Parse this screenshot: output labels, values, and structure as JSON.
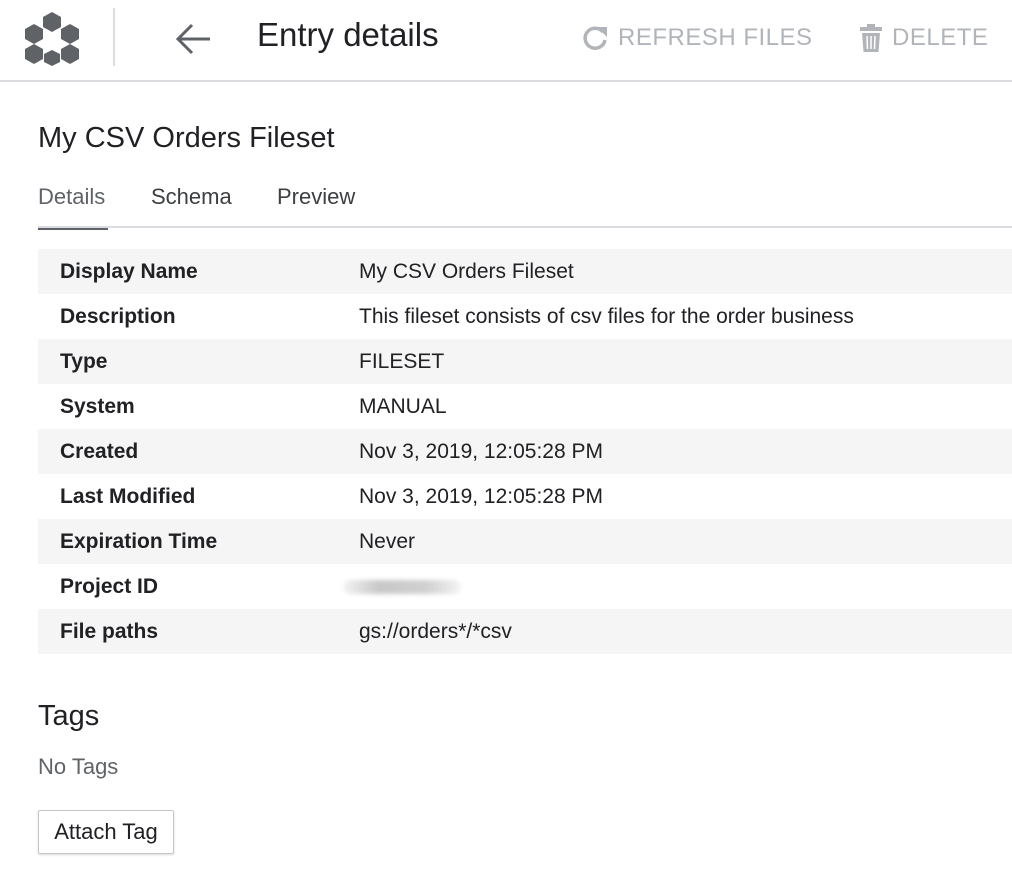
{
  "header": {
    "title": "Entry details",
    "logo_icon": "data-catalog-hexagon-icon",
    "back_icon": "arrow-left-icon",
    "refresh": {
      "label": "REFRESH FILES",
      "icon": "refresh-icon"
    },
    "delete": {
      "label": "DELETE",
      "icon": "trash-icon"
    },
    "disabled_color": "#b1b5ba"
  },
  "entry": {
    "name": "My CSV Orders Fileset"
  },
  "tabs": [
    {
      "label": "Details",
      "active": true
    },
    {
      "label": "Schema",
      "active": false
    },
    {
      "label": "Preview",
      "active": false
    }
  ],
  "details": {
    "rows": [
      {
        "label": "Display Name",
        "value": "My CSV Orders Fileset"
      },
      {
        "label": "Description",
        "value": "This fileset consists of csv files for the order business"
      },
      {
        "label": "Type",
        "value": "FILESET"
      },
      {
        "label": "System",
        "value": "MANUAL"
      },
      {
        "label": "Created",
        "value": "Nov 3, 2019, 12:05:28 PM"
      },
      {
        "label": "Last Modified",
        "value": "Nov 3, 2019, 12:05:28 PM"
      },
      {
        "label": "Expiration Time",
        "value": "Never"
      },
      {
        "label": "Project ID",
        "value": ""
      },
      {
        "label": "File paths",
        "value": "gs://orders*/*csv"
      }
    ]
  },
  "tags": {
    "title": "Tags",
    "empty_text": "No Tags",
    "attach_label": "Attach Tag"
  }
}
